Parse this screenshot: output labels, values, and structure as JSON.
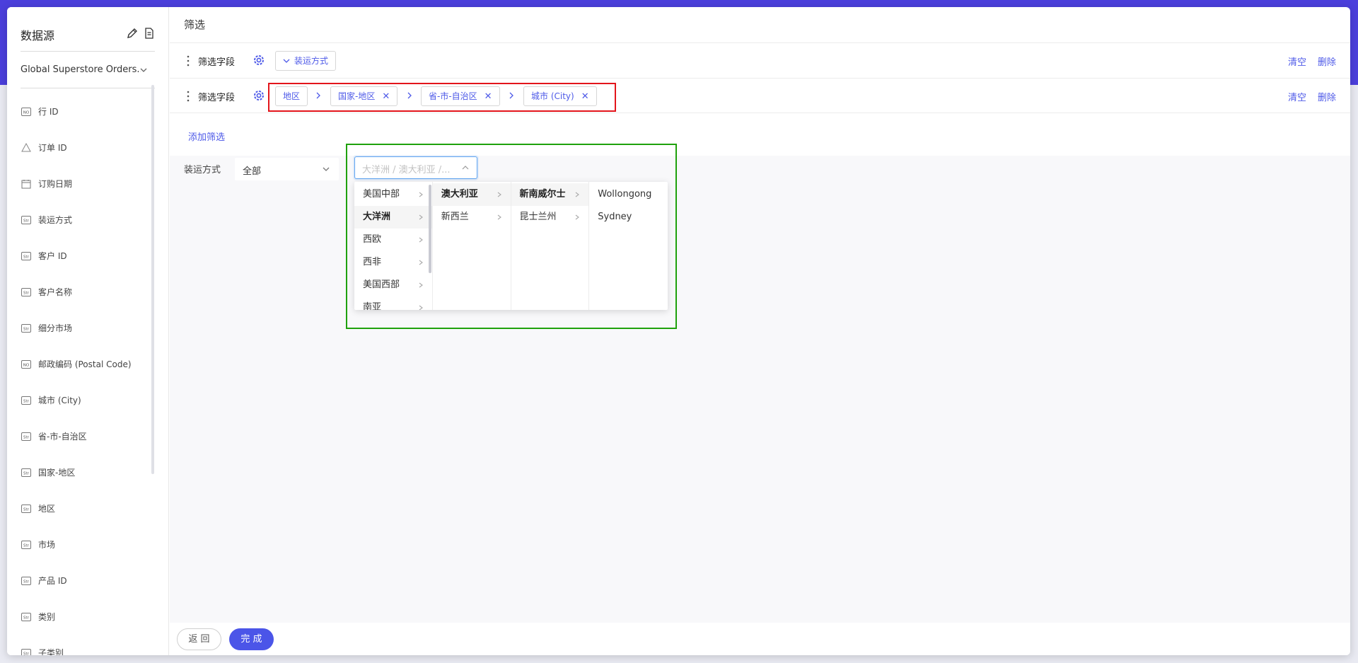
{
  "sidebar": {
    "title": "数据源",
    "datasource": "Global Superstore Orders...",
    "fields": [
      {
        "label": "行 ID",
        "type": "NO"
      },
      {
        "label": "订单 ID",
        "type": "recycle"
      },
      {
        "label": "订购日期",
        "type": "date"
      },
      {
        "label": "装运方式",
        "type": "Str"
      },
      {
        "label": "客户 ID",
        "type": "Str"
      },
      {
        "label": "客户名称",
        "type": "Str"
      },
      {
        "label": "细分市场",
        "type": "Str"
      },
      {
        "label": "邮政编码 (Postal Code)",
        "type": "NO"
      },
      {
        "label": "城市 (City)",
        "type": "Str"
      },
      {
        "label": "省-市-自治区",
        "type": "Str"
      },
      {
        "label": "国家-地区",
        "type": "Str"
      },
      {
        "label": "地区",
        "type": "Str"
      },
      {
        "label": "市场",
        "type": "Str"
      },
      {
        "label": "产品 ID",
        "type": "Str"
      },
      {
        "label": "类别",
        "type": "Str"
      },
      {
        "label": "子类别",
        "type": "Str"
      }
    ]
  },
  "main": {
    "title": "筛选",
    "filters": [
      {
        "label": "筛选字段",
        "chips": [
          "装运方式"
        ],
        "clear": "清空",
        "delete": "删除"
      },
      {
        "label": "筛选字段",
        "chips": [
          "地区",
          "国家-地区",
          "省-市-自治区",
          "城市 (City)"
        ],
        "clear": "清空",
        "delete": "删除"
      }
    ],
    "add_filter": "添加筛选",
    "preview": {
      "shipping_label": "装运方式",
      "shipping_value": "全部",
      "cascader_placeholder": "大洋洲 / 澳大利亚 /...",
      "columns": [
        [
          "美国中部",
          "大洋洲",
          "西欧",
          "西非",
          "美国西部",
          "南亚"
        ],
        [
          "澳大利亚",
          "新西兰"
        ],
        [
          "新南威尔士",
          "昆士兰州"
        ],
        [
          "Wollongong",
          "Sydney"
        ]
      ],
      "active": [
        1,
        0,
        0
      ]
    }
  },
  "footer": {
    "back": "返 回",
    "done": "完 成"
  },
  "colors": {
    "accent": "#4e5ae8",
    "header_band": "#4b3fdc",
    "red_highlight": "#e3151b",
    "green_highlight": "#1fa10c"
  }
}
